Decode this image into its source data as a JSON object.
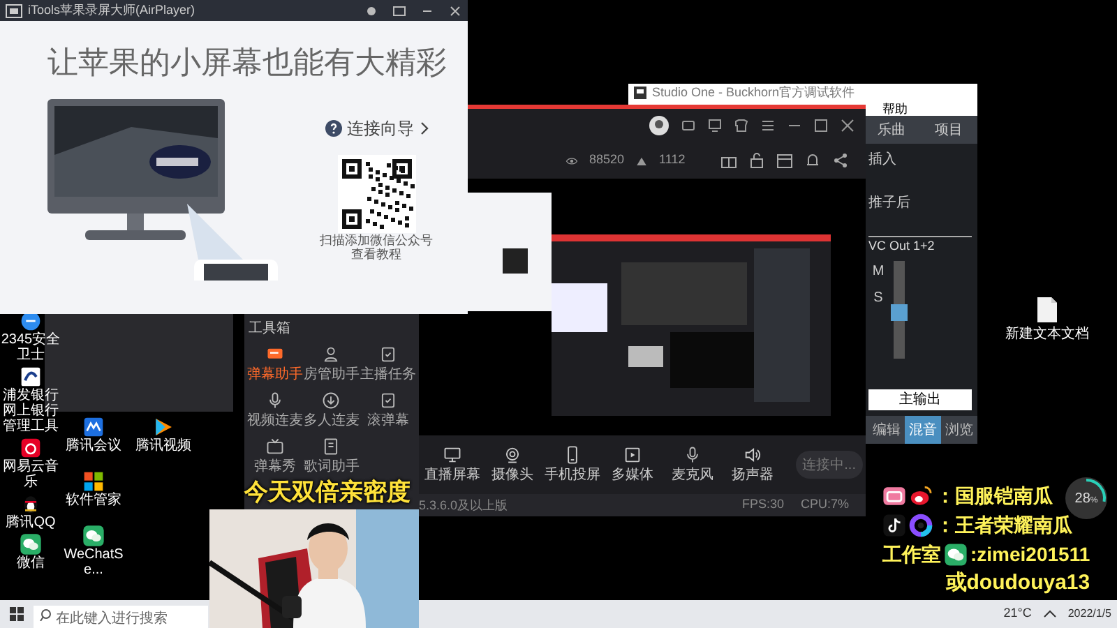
{
  "airplayer": {
    "title": "iTools苹果录屏大师(AirPlayer)",
    "headline": "让苹果的小屏幕也能有大精彩",
    "guide_link": "连接向导",
    "qr_caption": [
      "扫描添加微信公众号",
      "查看教程"
    ]
  },
  "studio_one": {
    "title": "Studio One - Buckhorn官方调试软件",
    "menu": [
      "帮助"
    ],
    "tabs": [
      {
        "label": "乐曲",
        "selected": false
      },
      {
        "label": "项目",
        "selected": false
      }
    ],
    "inserts": [
      "插入",
      "推子后"
    ],
    "channel_name": "VC Out 1+2",
    "buttons": [
      "M",
      "S"
    ],
    "fader": {
      "level": 0.45
    },
    "output_label": "主输出",
    "bottom_tabs": [
      {
        "label": "编辑",
        "selected": false
      },
      {
        "label": "混音",
        "selected": true
      },
      {
        "label": "浏览",
        "selected": false
      }
    ]
  },
  "live_app": {
    "stats": [
      {
        "kind": "eye",
        "text": "88520"
      },
      {
        "kind": "fans",
        "text": "1112"
      }
    ],
    "tools_title": "工具箱",
    "tools": [
      {
        "label": "弹幕助手",
        "kind": "chat",
        "active": true
      },
      {
        "label": "房管助手",
        "kind": "person",
        "active": false
      },
      {
        "label": "主播任务",
        "kind": "task",
        "active": false
      },
      {
        "label": "视频连麦",
        "kind": "mic",
        "active": false
      },
      {
        "label": "多人连麦",
        "kind": "download",
        "active": false
      },
      {
        "label": "滚弹幕",
        "kind": "task",
        "active": false
      },
      {
        "label": "弹幕秀",
        "kind": "tv",
        "active": false
      },
      {
        "label": "歌词助手",
        "kind": "book",
        "active": false
      }
    ],
    "controls": [
      {
        "label": "直播屏幕",
        "kind": "screen"
      },
      {
        "label": "摄像头",
        "kind": "camera"
      },
      {
        "label": "手机投屏",
        "kind": "phone"
      },
      {
        "label": "多媒体",
        "kind": "media"
      },
      {
        "label": "麦克风",
        "kind": "mic"
      },
      {
        "label": "扬声器",
        "kind": "speaker"
      }
    ],
    "connect_button": "连接中...",
    "version_note": "5.3.6.0及以上版",
    "status": [
      "FPS:30",
      "CPU:7%"
    ]
  },
  "desktop_columns": [
    {
      "icons": [
        {
          "label": "2345安全卫士",
          "kind": "shield"
        },
        {
          "label": "浦发银行网上银行管理工具",
          "kind": "bank"
        },
        {
          "label": "网易云音乐",
          "kind": "music"
        },
        {
          "label": "腾讯QQ",
          "kind": "penguin"
        },
        {
          "label": "微信",
          "kind": "wechat"
        }
      ]
    },
    {
      "icons": [
        {
          "label": "腾讯会议",
          "kind": "meeting"
        },
        {
          "label": "软件管家",
          "kind": "grid"
        },
        {
          "label": "WeChatSe...",
          "kind": "wechat"
        }
      ]
    },
    {
      "icons": [
        {
          "label": "腾讯视频",
          "kind": "video"
        }
      ]
    }
  ],
  "desktop_file": "新建文本文档",
  "overlay": {
    "banner": "今天双倍亲密度",
    "social": [
      {
        "kind": "video_sites",
        "text": "：国服铠南瓜"
      },
      {
        "kind": "short_video",
        "text": "：王者荣耀南瓜"
      },
      {
        "kind": "wechat",
        "prefix": "工作室",
        "text": ":zimei201511"
      }
    ],
    "alt_account": "或doudouya13",
    "meter": {
      "value": "28",
      "unit": "%"
    }
  },
  "taskbar": {
    "search_placeholder": "在此键入进行搜索",
    "weather": "21°C",
    "date": "2022/1/5"
  }
}
